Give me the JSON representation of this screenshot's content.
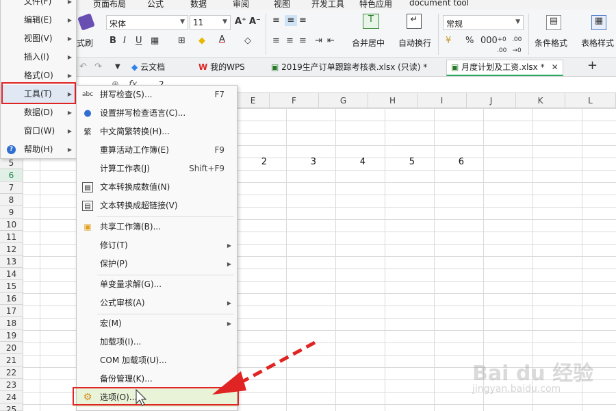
{
  "ribbon_tabs": [
    "页面布局",
    "公式",
    "数据",
    "审阅",
    "视图",
    "开发工具",
    "特色应用",
    "document tool"
  ],
  "ribbon": {
    "format_brush": "式刷",
    "font_name": "宋体",
    "font_size": "11",
    "merge_center": "合并居中",
    "wrap_text": "自动换行",
    "number_format": "常规",
    "percent": "%",
    "conditional_format": "条件格式",
    "table_style": "表格样式"
  },
  "doc_tabs": {
    "cloud": "云文档",
    "mywps": "我的WPS",
    "file1": "2019生产订单跟踪考核表.xlsx (只读) *",
    "file2": "月度计划及工资.xlsx *"
  },
  "formula_bar": {
    "fx": "fx",
    "value": "2"
  },
  "columns": [
    "E",
    "F",
    "G",
    "H",
    "I",
    "J",
    "K",
    "L"
  ],
  "rows": [
    "5",
    "6",
    "7",
    "8",
    "9",
    "10",
    "11",
    "12",
    "13",
    "14",
    "15",
    "16",
    "17",
    "18",
    "19",
    "20",
    "21",
    "22",
    "23",
    "24",
    "25"
  ],
  "row5_values": [
    "2",
    "3",
    "4",
    "5",
    "6"
  ],
  "main_menu": [
    {
      "label": "文件(F)"
    },
    {
      "label": "编辑(E)"
    },
    {
      "label": "视图(V)"
    },
    {
      "label": "插入(I)"
    },
    {
      "label": "格式(O)"
    },
    {
      "label": "工具(T)"
    },
    {
      "label": "数据(D)"
    },
    {
      "label": "窗口(W)"
    },
    {
      "label": "帮助(H)"
    }
  ],
  "tools_menu": [
    {
      "label": "拼写检查(S)...",
      "shortcut": "F7"
    },
    {
      "label": "设置拼写检查语言(C)...",
      "shortcut": ""
    },
    {
      "label": "中文简繁转换(H)...",
      "shortcut": ""
    },
    {
      "label": "重算活动工作簿(E)",
      "shortcut": "F9"
    },
    {
      "label": "计算工作表(J)",
      "shortcut": "Shift+F9"
    },
    {
      "label": "文本转换成数值(N)",
      "shortcut": ""
    },
    {
      "label": "文本转换成超链接(V)",
      "shortcut": ""
    },
    {
      "label": "共享工作簿(B)...",
      "shortcut": ""
    },
    {
      "label": "修订(T)",
      "shortcut": ""
    },
    {
      "label": "保护(P)",
      "shortcut": ""
    },
    {
      "label": "单变量求解(G)...",
      "shortcut": ""
    },
    {
      "label": "公式审核(A)",
      "shortcut": ""
    },
    {
      "label": "宏(M)",
      "shortcut": ""
    },
    {
      "label": "加载项(I)...",
      "shortcut": ""
    },
    {
      "label": "COM 加载项(U)...",
      "shortcut": ""
    },
    {
      "label": "备份管理(K)...",
      "shortcut": ""
    },
    {
      "label": "选项(O)...",
      "shortcut": ""
    }
  ],
  "watermark": {
    "logo": "Bai du 经验",
    "url": "jingyan.baidu.com"
  }
}
